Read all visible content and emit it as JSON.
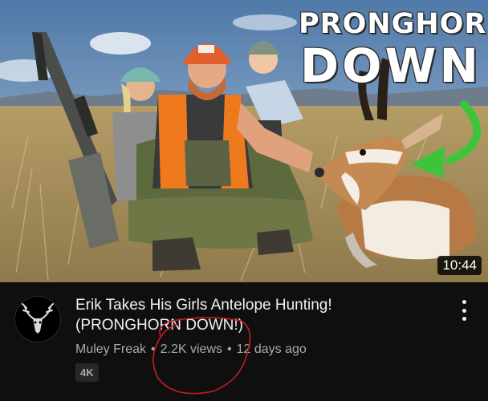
{
  "thumbnail": {
    "headline_line1": "PRONGHORN",
    "headline_line2": "DOWN",
    "duration": "10:44"
  },
  "video": {
    "title": "Erik Takes His Girls Antelope Hunting! (PRONGHORN DOWN!)",
    "channel": "Muley Freak",
    "views": "2.2K views",
    "age": "12 days ago",
    "separator": "•",
    "quality_badge": "4K"
  },
  "icons": {
    "channel_avatar": "deer-skull-logo-icon",
    "menu": "more-vert-icon"
  },
  "colors": {
    "background": "#0f0f0f",
    "title_text": "#f1f1f1",
    "secondary_text": "#aaaaaa",
    "arrow": "#3ec43a",
    "annotation": "#c21f1f"
  }
}
